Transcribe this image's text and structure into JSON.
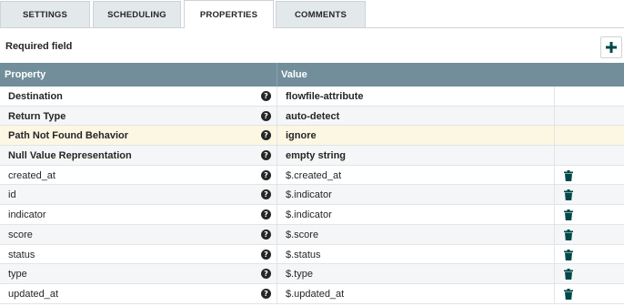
{
  "tabs": [
    {
      "label": "SETTINGS"
    },
    {
      "label": "SCHEDULING"
    },
    {
      "label": "PROPERTIES"
    },
    {
      "label": "COMMENTS"
    }
  ],
  "required_field_label": "Required field",
  "add_icon": "plus-icon",
  "table": {
    "headers": {
      "property": "Property",
      "value": "Value"
    },
    "rows": [
      {
        "name": "Destination",
        "value": "flowfile-attribute",
        "required": true
      },
      {
        "name": "Return Type",
        "value": "auto-detect",
        "required": true
      },
      {
        "name": "Path Not Found Behavior",
        "value": "ignore",
        "required": true
      },
      {
        "name": "Null Value Representation",
        "value": "empty string",
        "required": true
      },
      {
        "name": "created_at",
        "value": "$.created_at",
        "required": false
      },
      {
        "name": "id",
        "value": "$.indicator",
        "required": false
      },
      {
        "name": "indicator",
        "value": "$.indicator",
        "required": false
      },
      {
        "name": "score",
        "value": "$.score",
        "required": false
      },
      {
        "name": "status",
        "value": "$.status",
        "required": false
      },
      {
        "name": "type",
        "value": "$.type",
        "required": false
      },
      {
        "name": "updated_at",
        "value": "$.updated_at",
        "required": false
      }
    ]
  },
  "colors": {
    "header_bg": "#728e9b",
    "highlight_row": "#fcf7e3",
    "accent_add": "#004849"
  }
}
